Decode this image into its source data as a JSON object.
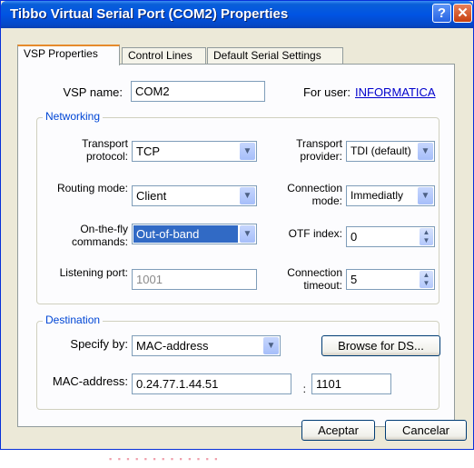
{
  "window": {
    "title": "Tibbo Virtual Serial Port (COM2) Properties",
    "help_label": "?",
    "close_label": "✕"
  },
  "tabs": [
    {
      "label": "VSP Properties",
      "active": true
    },
    {
      "label": "Control Lines",
      "active": false
    },
    {
      "label": "Default Serial Settings",
      "active": false
    }
  ],
  "vsp": {
    "name_label": "VSP name:",
    "name_value": "COM2",
    "for_user_label": "For user:",
    "for_user_value": "INFORMATICA"
  },
  "networking": {
    "legend": "Networking",
    "transport_protocol_label": "Transport protocol:",
    "transport_protocol_value": "TCP",
    "transport_provider_label": "Transport provider:",
    "transport_provider_value": "TDI (default)",
    "routing_mode_label": "Routing mode:",
    "routing_mode_value": "Client",
    "connection_mode_label": "Connection mode:",
    "connection_mode_value": "Immediatly",
    "onthefly_label": "On-the-fly commands:",
    "onthefly_value": "Out-of-band",
    "otf_index_label": "OTF index:",
    "otf_index_value": "0",
    "listening_port_label": "Listening port:",
    "listening_port_value": "1001",
    "connection_timeout_label": "Connection timeout:",
    "connection_timeout_value": "5"
  },
  "destination": {
    "legend": "Destination",
    "specify_by_label": "Specify by:",
    "specify_by_value": "MAC-address",
    "browse_label": "Browse for DS...",
    "mac_label": "MAC-address:",
    "mac_value": "0.24.77.1.44.51",
    "separator": ":",
    "port_value": "1101"
  },
  "footer": {
    "ok_label": "Aceptar",
    "cancel_label": "Cancelar"
  },
  "icons": {
    "dropdown": "chevron-down-icon",
    "spinner": "spinner-arrows-icon"
  }
}
